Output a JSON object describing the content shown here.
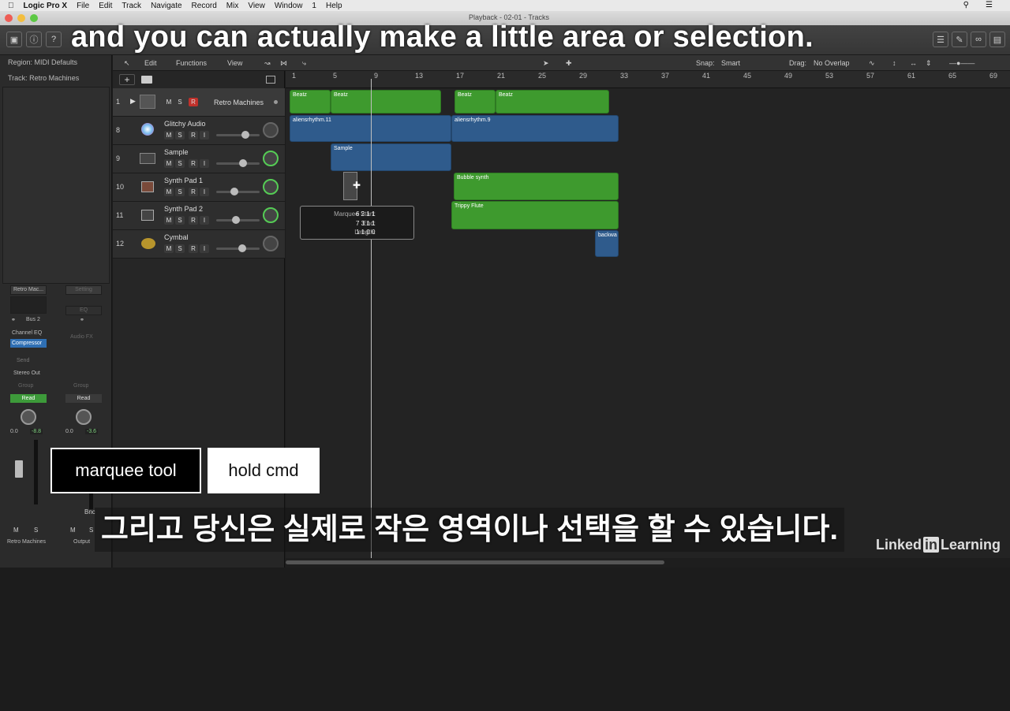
{
  "menubar": {
    "app": "Logic Pro X",
    "items": [
      "File",
      "Edit",
      "Track",
      "Navigate",
      "Record",
      "Mix",
      "View",
      "Window",
      "1",
      "Help"
    ]
  },
  "window": {
    "title": "Playback - 02-01 - Tracks"
  },
  "inspector": {
    "region": "Region: MIDI Defaults",
    "track": "Track: Retro Machines",
    "strip1": {
      "setting": "Retro Mac...",
      "io": "Bus 2",
      "eq": "Channel EQ",
      "fx": "Compressor",
      "send": "Send",
      "out": "Stereo Out",
      "group": "Group",
      "auto": "Read",
      "pan": "0.0",
      "vol": "-8.8",
      "m": "M",
      "s": "S",
      "name": "Retro Machines"
    },
    "strip2": {
      "setting": "Setting",
      "eq": "EQ",
      "fx": "Audio FX",
      "group": "Group",
      "auto": "Read",
      "pan": "0.0",
      "vol": "-3.6",
      "name": "Output",
      "m": "M",
      "s": "S",
      "label": "Bnc"
    }
  },
  "localbar": {
    "edit": "Edit",
    "functions": "Functions",
    "view": "View",
    "snap_label": "Snap:",
    "snap": "Smart",
    "drag_label": "Drag:",
    "drag": "No Overlap"
  },
  "ruler": [
    "1",
    "5",
    "9",
    "13",
    "17",
    "21",
    "25",
    "29",
    "33",
    "37",
    "41",
    "45",
    "49",
    "53",
    "57",
    "61",
    "65",
    "69"
  ],
  "tracks": [
    {
      "num": "1",
      "name": "Retro Machines",
      "m": "M",
      "s": "S",
      "r": "R"
    },
    {
      "num": "8",
      "name": "Glitchy Audio",
      "m": "M",
      "s": "S",
      "r": "R",
      "i": "I"
    },
    {
      "num": "9",
      "name": "Sample",
      "m": "M",
      "s": "S",
      "r": "R",
      "i": "I"
    },
    {
      "num": "10",
      "name": "Synth Pad 1",
      "m": "M",
      "s": "S",
      "r": "R",
      "i": "I"
    },
    {
      "num": "11",
      "name": "Synth Pad 2",
      "m": "M",
      "s": "S",
      "r": "R",
      "i": "I"
    },
    {
      "num": "12",
      "name": "Cymbal",
      "m": "M",
      "s": "S",
      "r": "R",
      "i": "I"
    }
  ],
  "regions": {
    "beatz1": "Beatz",
    "beatz2": "Beatz",
    "beatz3": "Beatz",
    "beatz4": "Beatz",
    "aliens1": "aliensrhythm.11",
    "aliens2": "aliensrhythm.9",
    "sample": "Sample",
    "bubble": "Bubble synth",
    "trippy": "Trippy Flute",
    "backw": "backwa"
  },
  "tooltip": {
    "start_label": "Marquee Start:",
    "start": "6 2 1 1",
    "end_label": "End:",
    "end": "7 3 1 1",
    "len_label": "Length:",
    "len": "1 1 0 0"
  },
  "captions": {
    "top": "and you can actually make a little area or selection.",
    "bottom": "그리고 당신은 실제로 작은 영역이나 선택을 할 수 있습니다."
  },
  "tags": {
    "tool": "marquee tool",
    "hold": "hold cmd"
  },
  "watermark": "Linked in Learning"
}
